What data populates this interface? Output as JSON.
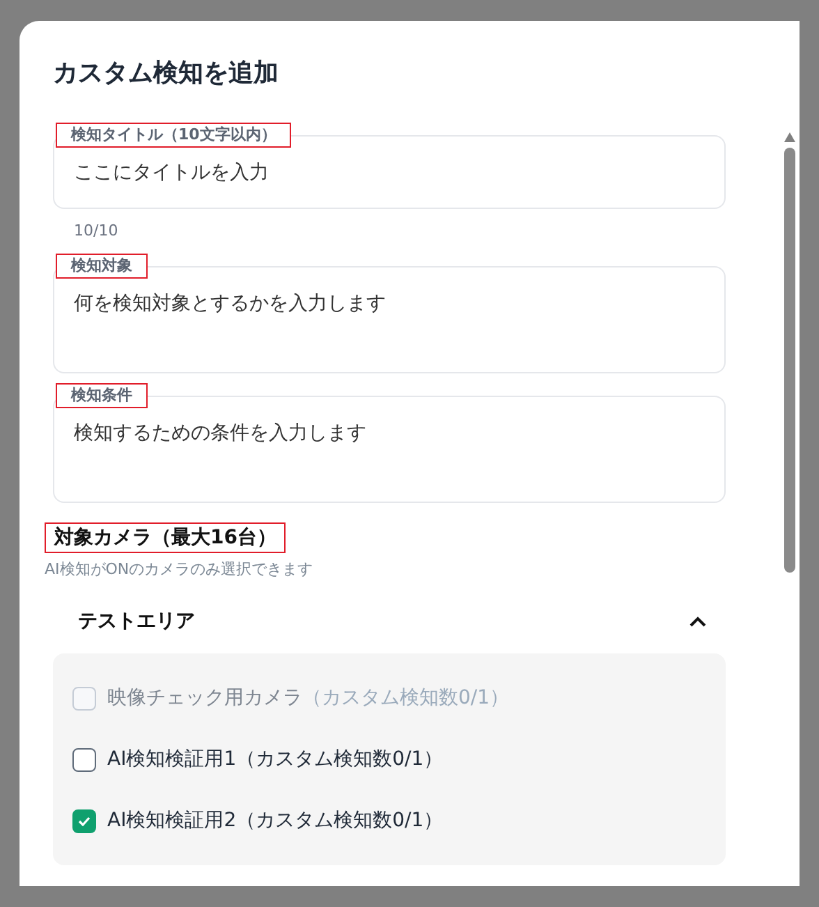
{
  "dialog": {
    "title": "カスタム検知を追加"
  },
  "fields": [
    {
      "label": "検知タイトル（10文字以内）",
      "value": "ここにタイトルを入力",
      "counter": "10/10",
      "kind": "input"
    },
    {
      "label": "検知対象",
      "value": "何を検知対象とするかを入力します",
      "kind": "textarea"
    },
    {
      "label": "検知条件",
      "value": "検知するための条件を入力します",
      "kind": "textarea"
    }
  ],
  "cameras": {
    "heading": "対象カメラ（最大16台）",
    "hint": "AI検知がONのカメラのみ選択できます",
    "group": {
      "name": "テストエリア",
      "expanded": true,
      "items": [
        {
          "name": "映像チェック用カメラ",
          "count": "（カスタム検知数0/1）",
          "checked": false,
          "disabled": true
        },
        {
          "name": "AI検知検証用1",
          "count": "（カスタム検知数0/1）",
          "checked": false,
          "disabled": false
        },
        {
          "name": "AI検知検証用2",
          "count": "（カスタム検知数0/1）",
          "checked": true,
          "disabled": false
        }
      ]
    }
  }
}
